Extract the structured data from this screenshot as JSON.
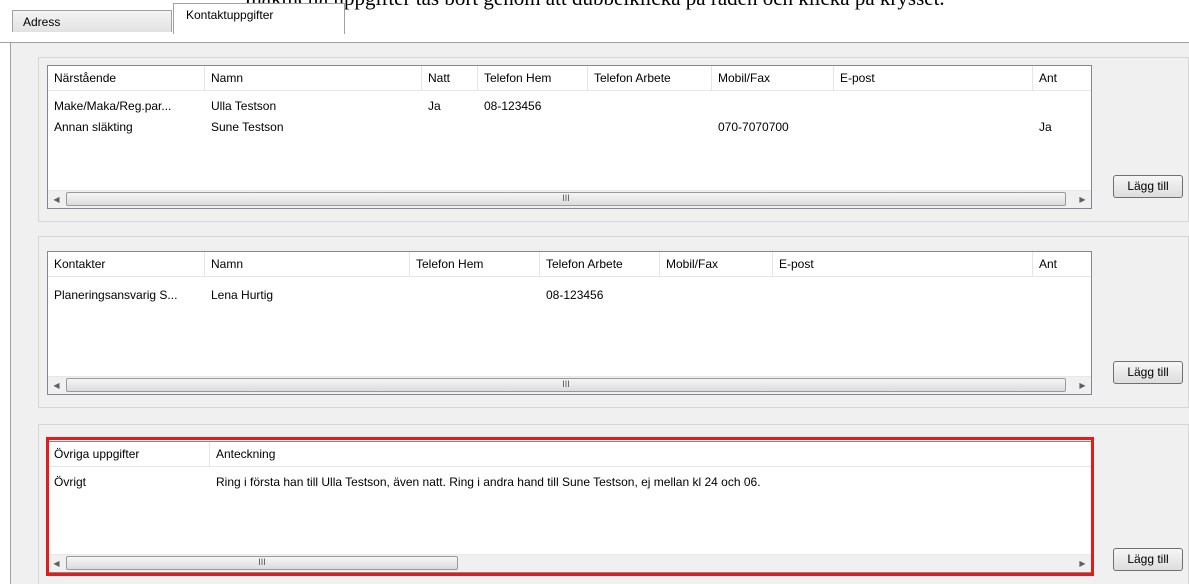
{
  "document": {
    "caption": "Inaktuella uppgifter tas bort genom att dubbelklicka på raden och klicka på krysset."
  },
  "tabs": [
    {
      "label": "Adress"
    },
    {
      "label": "Kontaktuppgifter"
    }
  ],
  "narstaende": {
    "headers": [
      "Närstående",
      "Namn",
      "Natt",
      "Telefon Hem",
      "Telefon Arbete",
      "Mobil/Fax",
      "E-post",
      "Ant"
    ],
    "rows": [
      [
        "Make/Maka/Reg.par...",
        "Ulla Testson",
        "Ja",
        "08-123456",
        "",
        "",
        "",
        ""
      ],
      [
        "Annan släkting",
        "Sune Testson",
        "",
        "",
        "",
        "070-7070700",
        "",
        "Ja"
      ]
    ],
    "add_label": "Lägg till",
    "scroll_thumb_glyph": "III"
  },
  "kontakter": {
    "headers": [
      "Kontakter",
      "Namn",
      "Telefon Hem",
      "Telefon Arbete",
      "Mobil/Fax",
      "E-post",
      "Ant"
    ],
    "rows": [
      [
        "Planeringsansvarig S...",
        "Lena Hurtig",
        "",
        "08-123456",
        "",
        "",
        ""
      ]
    ],
    "add_label": "Lägg till",
    "scroll_thumb_glyph": "III"
  },
  "ovriga": {
    "headers": [
      "Övriga uppgifter",
      "Anteckning"
    ],
    "rows": [
      [
        "Övrigt",
        "Ring i första han till Ulla Testson, även natt. Ring i andra hand till Sune Testson, ej mellan kl 24 och 06."
      ]
    ],
    "add_label": "Lägg till",
    "scroll_thumb_glyph": "III"
  },
  "scroll_arrows": {
    "left": "◀",
    "right": "▶"
  },
  "colors": {
    "highlight": "#e41b1b"
  }
}
